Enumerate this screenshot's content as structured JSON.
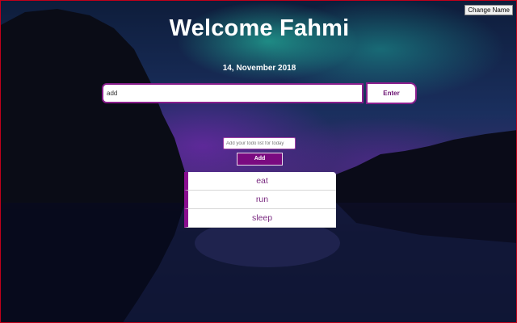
{
  "header": {
    "change_name_label": "Change Name",
    "title": "Welcome Fahmi",
    "date": "14, November 2018"
  },
  "search": {
    "value": "add",
    "enter_label": "Enter"
  },
  "todo_form": {
    "placeholder": "Add your todo list for today",
    "add_label": "Add"
  },
  "todos": [
    {
      "label": "eat"
    },
    {
      "label": "run"
    },
    {
      "label": "sleep"
    }
  ],
  "colors": {
    "accent": "#8a0e90",
    "button_fill": "#7a0a80",
    "frame_border": "#c0001a"
  }
}
